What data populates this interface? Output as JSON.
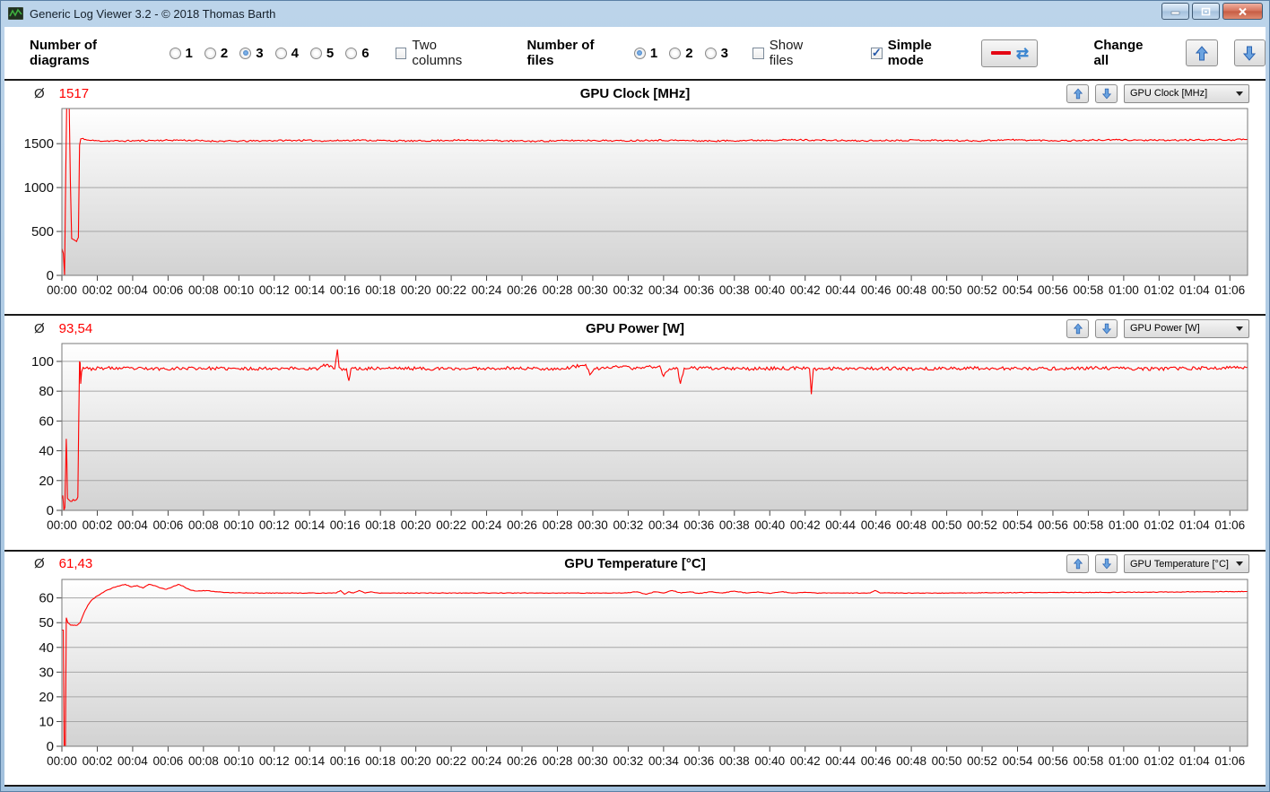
{
  "window": {
    "title": "Generic Log Viewer 3.2 - © 2018 Thomas Barth",
    "buttons": {
      "minimize": "minimize",
      "restore": "restore",
      "close": "close"
    }
  },
  "toolbar": {
    "diagrams_label": "Number of diagrams",
    "diagram_options": [
      "1",
      "2",
      "3",
      "4",
      "5",
      "6"
    ],
    "diagrams_selected": "3",
    "two_columns_label": "Two columns",
    "two_columns_checked": false,
    "files_label": "Number of files",
    "file_options": [
      "1",
      "2",
      "3"
    ],
    "files_selected": "1",
    "show_files_label": "Show files",
    "show_files_checked": false,
    "simple_mode_label": "Simple mode",
    "simple_mode_checked": true,
    "change_all_label": "Change all"
  },
  "colors": {
    "accent_blue": "#3f77bc",
    "line_red": "#ff0000",
    "avg_red": "#ff0000",
    "grid": "#a6a6a6",
    "plot_border": "#7a7a7a",
    "plot_bg_top": "#ffffff",
    "plot_bg_bottom": "#d2d2d2",
    "titlebar_top": "#bcd4ea",
    "titlebar_bottom": "#a3c2de"
  },
  "time_axis": {
    "labels": [
      "00:00",
      "00:02",
      "00:04",
      "00:06",
      "00:08",
      "00:10",
      "00:12",
      "00:14",
      "00:16",
      "00:18",
      "00:20",
      "00:22",
      "00:24",
      "00:26",
      "00:28",
      "00:30",
      "00:32",
      "00:34",
      "00:36",
      "00:38",
      "00:40",
      "00:42",
      "00:44",
      "00:46",
      "00:48",
      "00:50",
      "00:52",
      "00:54",
      "00:56",
      "00:58",
      "01:00",
      "01:02",
      "01:04",
      "01:06"
    ],
    "interval_s": 120,
    "t_max_s": 4020
  },
  "chart_data": [
    {
      "type": "line",
      "title": "GPU Clock [MHz]",
      "selector_value": "GPU Clock [MHz]",
      "average_label": "Ø",
      "average": "1517",
      "ylim": [
        0,
        1900
      ],
      "yticks": [
        0,
        500,
        1000,
        1500
      ],
      "line_color": "#ff0000",
      "noise": 9,
      "seed": 11,
      "keypoints": [
        [
          0,
          305
        ],
        [
          5,
          250
        ],
        [
          9,
          5
        ],
        [
          13,
          1150
        ],
        [
          16,
          1900
        ],
        [
          25,
          1900
        ],
        [
          29,
          1050
        ],
        [
          33,
          420
        ],
        [
          50,
          385
        ],
        [
          56,
          430
        ],
        [
          60,
          1480
        ],
        [
          64,
          1555
        ],
        [
          72,
          1560
        ],
        [
          85,
          1540
        ],
        [
          120,
          1532
        ],
        [
          200,
          1530
        ],
        [
          300,
          1536
        ],
        [
          400,
          1540
        ],
        [
          500,
          1530
        ],
        [
          600,
          1528
        ],
        [
          700,
          1534
        ],
        [
          800,
          1538
        ],
        [
          900,
          1532
        ],
        [
          1000,
          1540
        ],
        [
          1100,
          1534
        ],
        [
          1200,
          1530
        ],
        [
          1300,
          1537
        ],
        [
          1400,
          1540
        ],
        [
          1500,
          1532
        ],
        [
          1600,
          1528
        ],
        [
          1700,
          1534
        ],
        [
          1800,
          1537
        ],
        [
          1900,
          1532
        ],
        [
          2000,
          1540
        ],
        [
          2100,
          1536
        ],
        [
          2200,
          1530
        ],
        [
          2300,
          1536
        ],
        [
          2400,
          1540
        ],
        [
          2500,
          1543
        ],
        [
          2600,
          1538
        ],
        [
          2700,
          1532
        ],
        [
          2800,
          1537
        ],
        [
          2900,
          1540
        ],
        [
          3000,
          1536
        ],
        [
          3100,
          1532
        ],
        [
          3200,
          1544
        ],
        [
          3300,
          1538
        ],
        [
          3400,
          1534
        ],
        [
          3500,
          1540
        ],
        [
          3600,
          1543
        ],
        [
          3700,
          1537
        ],
        [
          3800,
          1540
        ],
        [
          3900,
          1544
        ],
        [
          3960,
          1542
        ],
        [
          4020,
          1548
        ]
      ]
    },
    {
      "type": "line",
      "title": "GPU Power [W]",
      "selector_value": "GPU Power [W]",
      "average_label": "Ø",
      "average": "93,54",
      "ylim": [
        0,
        112
      ],
      "yticks": [
        0,
        20,
        40,
        60,
        80,
        100
      ],
      "line_color": "#ff0000",
      "noise": 1.1,
      "seed": 23,
      "keypoints": [
        [
          0,
          8
        ],
        [
          3,
          10
        ],
        [
          7,
          0
        ],
        [
          10,
          2
        ],
        [
          13,
          30
        ],
        [
          15,
          48
        ],
        [
          17,
          32
        ],
        [
          19,
          8
        ],
        [
          24,
          7
        ],
        [
          48,
          7
        ],
        [
          54,
          9
        ],
        [
          57,
          55
        ],
        [
          60,
          100
        ],
        [
          62,
          99
        ],
        [
          64,
          85
        ],
        [
          67,
          93
        ],
        [
          72,
          96
        ],
        [
          90,
          95
        ],
        [
          150,
          95.5
        ],
        [
          300,
          95
        ],
        [
          450,
          95.5
        ],
        [
          600,
          95
        ],
        [
          750,
          95.5
        ],
        [
          870,
          95
        ],
        [
          897,
          98
        ],
        [
          925,
          95
        ],
        [
          934,
          108
        ],
        [
          940,
          96
        ],
        [
          950,
          94
        ],
        [
          965,
          95
        ],
        [
          973,
          87
        ],
        [
          980,
          95
        ],
        [
          1100,
          95.5
        ],
        [
          1300,
          95
        ],
        [
          1500,
          95.5
        ],
        [
          1700,
          95
        ],
        [
          1776,
          98
        ],
        [
          1790,
          91
        ],
        [
          1810,
          95
        ],
        [
          1913,
          97
        ],
        [
          1930,
          95
        ],
        [
          2027,
          97
        ],
        [
          2040,
          90
        ],
        [
          2060,
          95
        ],
        [
          2088,
          95
        ],
        [
          2097,
          85
        ],
        [
          2110,
          95.5
        ],
        [
          2300,
          95
        ],
        [
          2500,
          95.5
        ],
        [
          2535,
          95
        ],
        [
          2541,
          78
        ],
        [
          2548,
          95
        ],
        [
          2700,
          95.5
        ],
        [
          2900,
          95
        ],
        [
          3100,
          95.5
        ],
        [
          3300,
          95
        ],
        [
          3500,
          95.5
        ],
        [
          3700,
          95
        ],
        [
          3900,
          95.5
        ],
        [
          4020,
          96
        ]
      ]
    },
    {
      "type": "line",
      "title": "GPU Temperature [°C]",
      "selector_value": "GPU Temperature [°C]",
      "average_label": "Ø",
      "average": "61,43",
      "ylim": [
        0,
        67.5
      ],
      "yticks": [
        0,
        10,
        20,
        30,
        40,
        50,
        60
      ],
      "line_color": "#ff0000",
      "noise": 0.12,
      "seed": 5,
      "keypoints": [
        [
          0,
          47
        ],
        [
          5,
          47
        ],
        [
          8,
          0
        ],
        [
          12,
          0
        ],
        [
          15,
          52
        ],
        [
          20,
          50
        ],
        [
          30,
          49
        ],
        [
          52,
          49
        ],
        [
          62,
          50
        ],
        [
          75,
          54
        ],
        [
          88,
          57
        ],
        [
          100,
          59
        ],
        [
          115,
          60.5
        ],
        [
          130,
          61.5
        ],
        [
          150,
          63
        ],
        [
          170,
          64
        ],
        [
          190,
          64.8
        ],
        [
          215,
          65.5
        ],
        [
          235,
          64.5
        ],
        [
          255,
          65
        ],
        [
          275,
          64
        ],
        [
          295,
          65.5
        ],
        [
          315,
          65
        ],
        [
          335,
          64
        ],
        [
          355,
          63.5
        ],
        [
          375,
          64.5
        ],
        [
          395,
          65.5
        ],
        [
          415,
          64.5
        ],
        [
          435,
          63.2
        ],
        [
          460,
          62.8
        ],
        [
          490,
          63
        ],
        [
          520,
          62.5
        ],
        [
          560,
          62.2
        ],
        [
          640,
          62
        ],
        [
          900,
          62
        ],
        [
          930,
          62
        ],
        [
          945,
          63
        ],
        [
          958,
          61.5
        ],
        [
          972,
          62.5
        ],
        [
          988,
          62
        ],
        [
          1008,
          63
        ],
        [
          1028,
          62
        ],
        [
          1048,
          62.5
        ],
        [
          1074,
          62
        ],
        [
          1300,
          62
        ],
        [
          1600,
          62
        ],
        [
          1900,
          62
        ],
        [
          1950,
          62.5
        ],
        [
          1980,
          61.5
        ],
        [
          2010,
          62.5
        ],
        [
          2040,
          62
        ],
        [
          2070,
          63
        ],
        [
          2100,
          62
        ],
        [
          2130,
          62.5
        ],
        [
          2160,
          61.8
        ],
        [
          2200,
          62.5
        ],
        [
          2240,
          62
        ],
        [
          2280,
          62.8
        ],
        [
          2320,
          62
        ],
        [
          2360,
          62.5
        ],
        [
          2400,
          61.8
        ],
        [
          2440,
          62.5
        ],
        [
          2480,
          62
        ],
        [
          2520,
          62.3
        ],
        [
          2558,
          62
        ],
        [
          2740,
          62
        ],
        [
          2757,
          63
        ],
        [
          2775,
          62
        ],
        [
          3000,
          62
        ],
        [
          3300,
          62.2
        ],
        [
          3600,
          62.3
        ],
        [
          3900,
          62.5
        ],
        [
          4020,
          62.6
        ]
      ]
    }
  ]
}
